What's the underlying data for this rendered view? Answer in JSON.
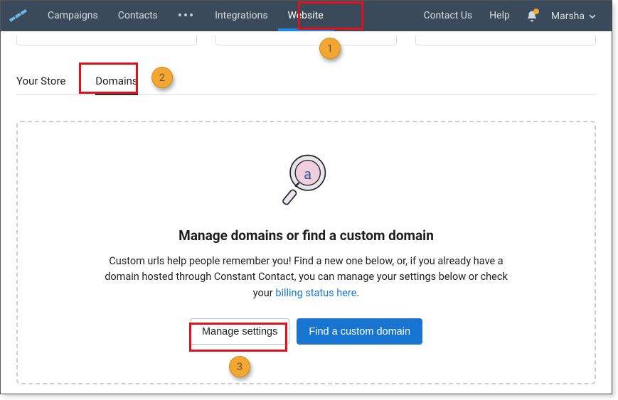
{
  "nav": {
    "items": [
      "Campaigns",
      "Contacts",
      "Integrations",
      "Website"
    ]
  },
  "nav_right": {
    "contact": "Contact Us",
    "help": "Help",
    "user": "Marsha"
  },
  "tabs": {
    "store": "Your Store",
    "domains": "Domains"
  },
  "panel": {
    "title": "Manage domains or find a custom domain",
    "desc_pre": "Custom urls help people remember you! Find a new one below, or, if you already have a domain hosted through Constant Contact, you can manage your settings below or check your ",
    "desc_link": "billing status here",
    "desc_post": ".",
    "manage_btn": "Manage settings",
    "find_btn": "Find a custom domain"
  },
  "badges": {
    "b1": "1",
    "b2": "2",
    "b3": "3"
  }
}
